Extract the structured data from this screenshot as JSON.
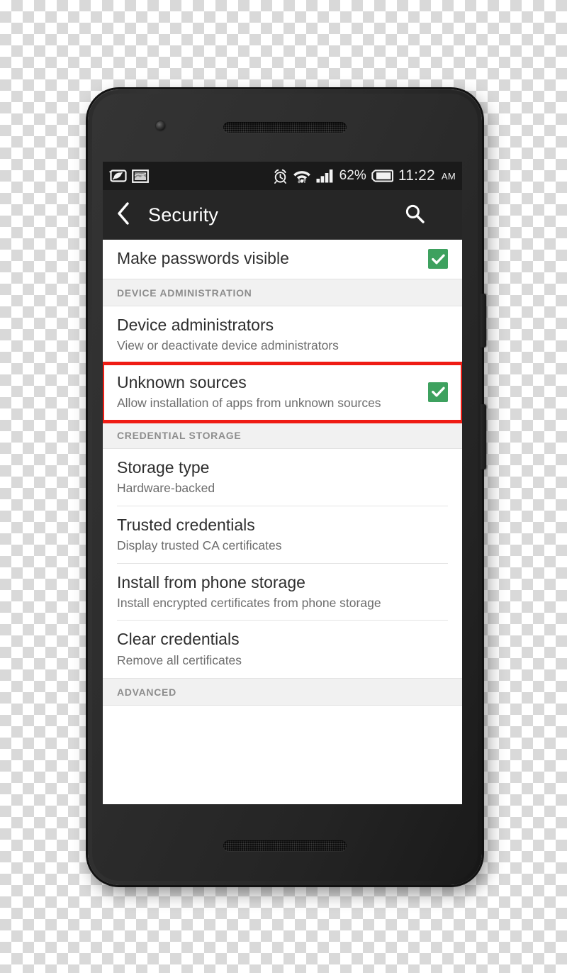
{
  "status_bar": {
    "left_icons": [
      {
        "name": "eco-mode-icon",
        "glyph": "leaf-in-rect"
      },
      {
        "name": "screenshot-icon",
        "glyph": "image-in-rect"
      }
    ],
    "right_icons": [
      {
        "name": "alarm-clock-icon"
      },
      {
        "name": "wifi-icon"
      },
      {
        "name": "signal-bars-icon"
      }
    ],
    "battery_percent": "62%",
    "time": "11:22",
    "ampm": "AM"
  },
  "action_bar": {
    "back_icon": "back-chevron-icon",
    "title": "Security",
    "search_icon": "search-icon",
    "overflow_icon": "overflow-menu-icon"
  },
  "accent": {
    "checkbox_green": "#3ea15f",
    "highlight_red": "#ef1c14",
    "status_bar_bg": "#1a1a1a",
    "action_bar_bg": "#262626",
    "section_header_bg": "#f1f1f1"
  },
  "list": [
    {
      "kind": "row",
      "name": "row-make-passwords-visible",
      "title": "Make passwords visible",
      "summary": "",
      "checkbox": true,
      "checked": true,
      "highlighted": false,
      "divider": false
    },
    {
      "kind": "header",
      "name": "section-header-device-administration",
      "title": "DEVICE ADMINISTRATION"
    },
    {
      "kind": "row",
      "name": "row-device-administrators",
      "title": "Device administrators",
      "summary": "View or deactivate device administrators",
      "checkbox": false,
      "checked": false,
      "highlighted": false,
      "divider": false
    },
    {
      "kind": "row",
      "name": "row-unknown-sources",
      "title": "Unknown sources",
      "summary": "Allow installation of apps from unknown sources",
      "checkbox": true,
      "checked": true,
      "highlighted": true,
      "divider": false
    },
    {
      "kind": "header",
      "name": "section-header-credential-storage",
      "title": "CREDENTIAL STORAGE"
    },
    {
      "kind": "row",
      "name": "row-storage-type",
      "title": "Storage type",
      "summary": "Hardware-backed",
      "checkbox": false,
      "checked": false,
      "highlighted": false,
      "divider": true
    },
    {
      "kind": "row",
      "name": "row-trusted-credentials",
      "title": "Trusted credentials",
      "summary": "Display trusted CA certificates",
      "checkbox": false,
      "checked": false,
      "highlighted": false,
      "divider": true
    },
    {
      "kind": "row",
      "name": "row-install-from-phone-storage",
      "title": "Install from phone storage",
      "summary": "Install encrypted certificates from phone storage",
      "checkbox": false,
      "checked": false,
      "highlighted": false,
      "divider": true
    },
    {
      "kind": "row",
      "name": "row-clear-credentials",
      "title": "Clear credentials",
      "summary": "Remove all certificates",
      "checkbox": false,
      "checked": false,
      "highlighted": false,
      "divider": false
    },
    {
      "kind": "header",
      "name": "section-header-advanced",
      "title": "ADVANCED"
    }
  ],
  "hardware": {
    "earpiece": "earpiece-speaker",
    "front_camera": "front-camera",
    "bottom_speaker": "bottom-speaker",
    "volume_button": "volume-button",
    "power_button": "power-button"
  }
}
